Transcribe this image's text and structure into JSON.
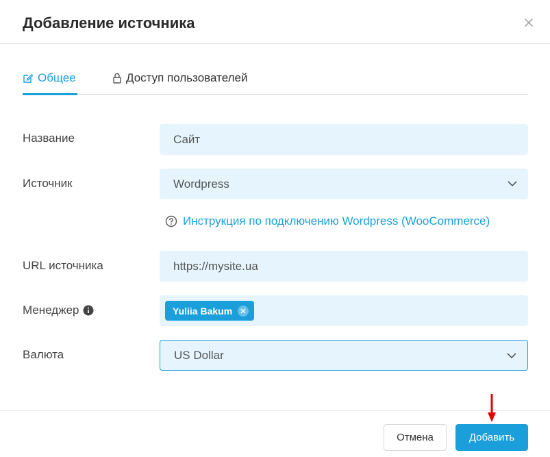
{
  "dialog": {
    "title": "Добавление источника"
  },
  "tabs": [
    {
      "label": "Общее",
      "icon": "edit-icon",
      "active": true
    },
    {
      "label": "Доступ пользователей",
      "icon": "lock-icon",
      "active": false
    }
  ],
  "form": {
    "name": {
      "label": "Название",
      "value": "Сайт"
    },
    "source": {
      "label": "Источник",
      "value": "Wordpress"
    },
    "help_link": "Инструкция по подключению Wordpress (WooCommerce)",
    "url": {
      "label": "URL источника",
      "value": "https://mysite.ua"
    },
    "manager": {
      "label": "Менеджер",
      "chip": "Yuliia Bakum"
    },
    "currency": {
      "label": "Валюта",
      "value": "US Dollar"
    }
  },
  "footer": {
    "cancel_label": "Отмена",
    "add_label": "Добавить"
  },
  "colors": {
    "accent": "#1a9fdb",
    "field_bg": "#e6f5fd",
    "annotation_arrow": "#e60000"
  }
}
